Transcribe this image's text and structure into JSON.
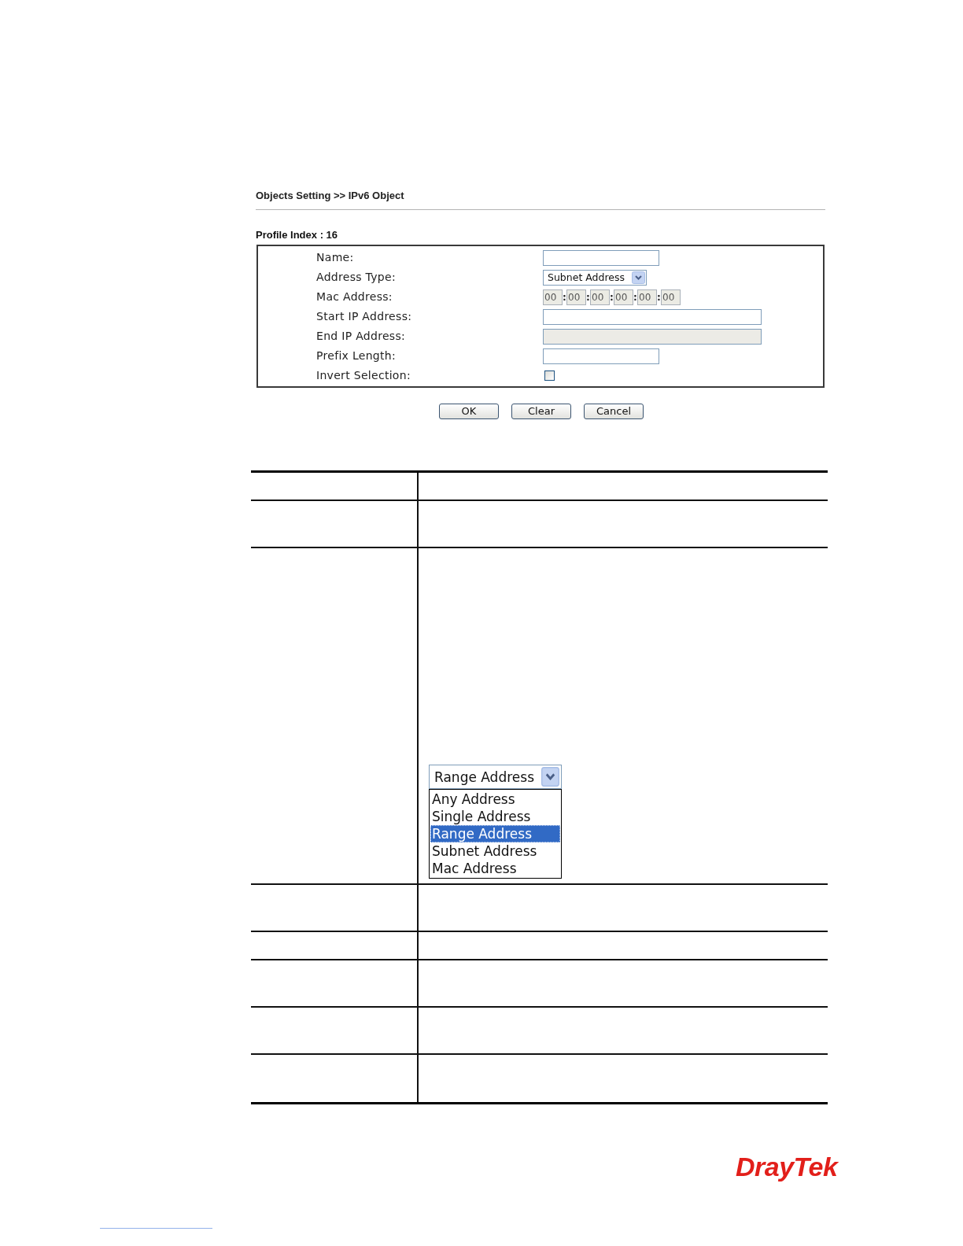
{
  "header": {
    "breadcrumb": "Objects Setting >> IPv6 Object"
  },
  "form": {
    "title": "Profile Index : 16",
    "fields": [
      {
        "kind": "short_text",
        "label": "Name:",
        "disabled": false
      },
      {
        "kind": "select",
        "label": "Address Type:",
        "value": "Subnet Address"
      },
      {
        "kind": "mac",
        "label": "Mac Address:",
        "disabled": true,
        "segments": [
          {
            "value": "00"
          },
          {
            "prefix": ":",
            "value": "00"
          },
          {
            "prefix": ":",
            "value": "00"
          },
          {
            "prefix": ":",
            "value": "00"
          },
          {
            "prefix": ":",
            "value": "00"
          },
          {
            "prefix": ":",
            "value": "00"
          }
        ]
      },
      {
        "kind": "long_text",
        "label": "Start IP Address:",
        "disabled": false
      },
      {
        "kind": "long_text",
        "label": "End IP Address:",
        "disabled": true
      },
      {
        "kind": "short_text",
        "label": "Prefix Length:",
        "disabled": false
      },
      {
        "kind": "checkbox",
        "label": "Invert Selection:",
        "checked": false
      }
    ]
  },
  "buttons": [
    "OK",
    "Clear",
    "Cancel"
  ],
  "table": {
    "rows": [
      {
        "kind": "single_line"
      },
      {
        "kind": "two_line"
      },
      {
        "kind": "figure",
        "figure": {
          "value": "Range Address",
          "options": [
            {
              "label": "Any Address",
              "selected": false
            },
            {
              "label": "Single Address",
              "selected": false
            },
            {
              "label": "Range Address",
              "selected": true
            },
            {
              "label": "Subnet Address",
              "selected": false
            },
            {
              "label": "Mac Address",
              "selected": false
            }
          ]
        }
      },
      {
        "kind": "two_line"
      },
      {
        "kind": "single_line"
      },
      {
        "kind": "two_line"
      },
      {
        "kind": "two_line"
      },
      {
        "kind": "two_line"
      }
    ]
  },
  "logo": "DrayTek"
}
